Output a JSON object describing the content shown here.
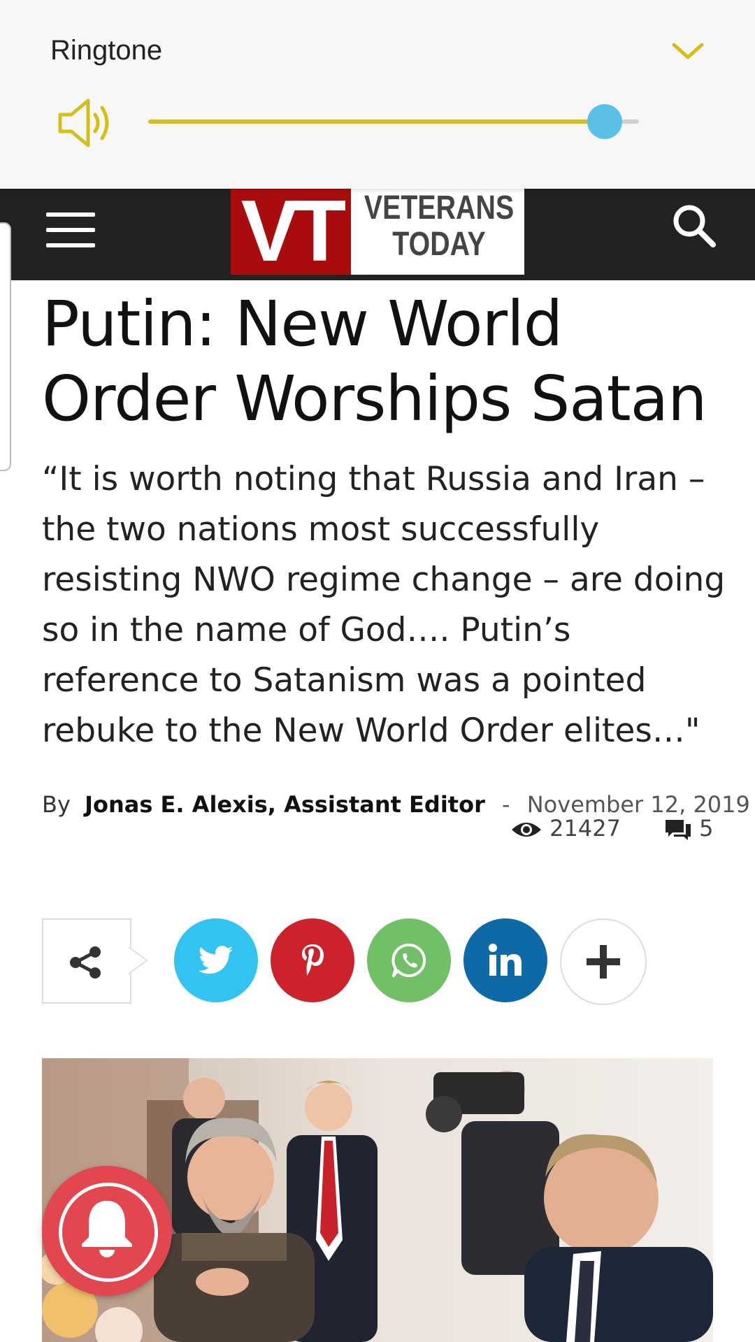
{
  "volume_panel": {
    "label": "Ringtone",
    "level": 0.93,
    "accent_color": "#d4bf16",
    "thumb_color": "#5bc0e8",
    "icons": [
      "speaker-icon",
      "chevron-down-icon"
    ]
  },
  "header": {
    "logo_mark": "VT",
    "logo_line1": "VETERANS",
    "logo_line2": "TODAY",
    "icons": [
      "menu-icon",
      "search-icon"
    ]
  },
  "article": {
    "title": "Putin: New World Order Worships Satan",
    "excerpt": "“It is worth noting that Russia and Iran – the two nations most successfully resisting NWO regime change – are doing so in the name of God…. Putin’s reference to Satanism was a pointed rebuke to the New World Order elites…\"",
    "by_label": "By",
    "author": "Jonas E. Alexis, Assistant Editor",
    "separator": "-",
    "date": "November 12, 2019",
    "views": "21427",
    "comments": "5"
  },
  "share": {
    "icons": [
      "share-icon",
      "twitter-icon",
      "pinterest-icon",
      "whatsapp-icon",
      "linkedin-icon",
      "plus-icon"
    ],
    "colors": {
      "twitter": "#32c3f0",
      "pinterest": "#cc222b",
      "whatsapp": "#71bf67",
      "linkedin": "#0e6aa6"
    }
  },
  "notification": {
    "icon": "bell-icon",
    "color": "#e2474f"
  }
}
